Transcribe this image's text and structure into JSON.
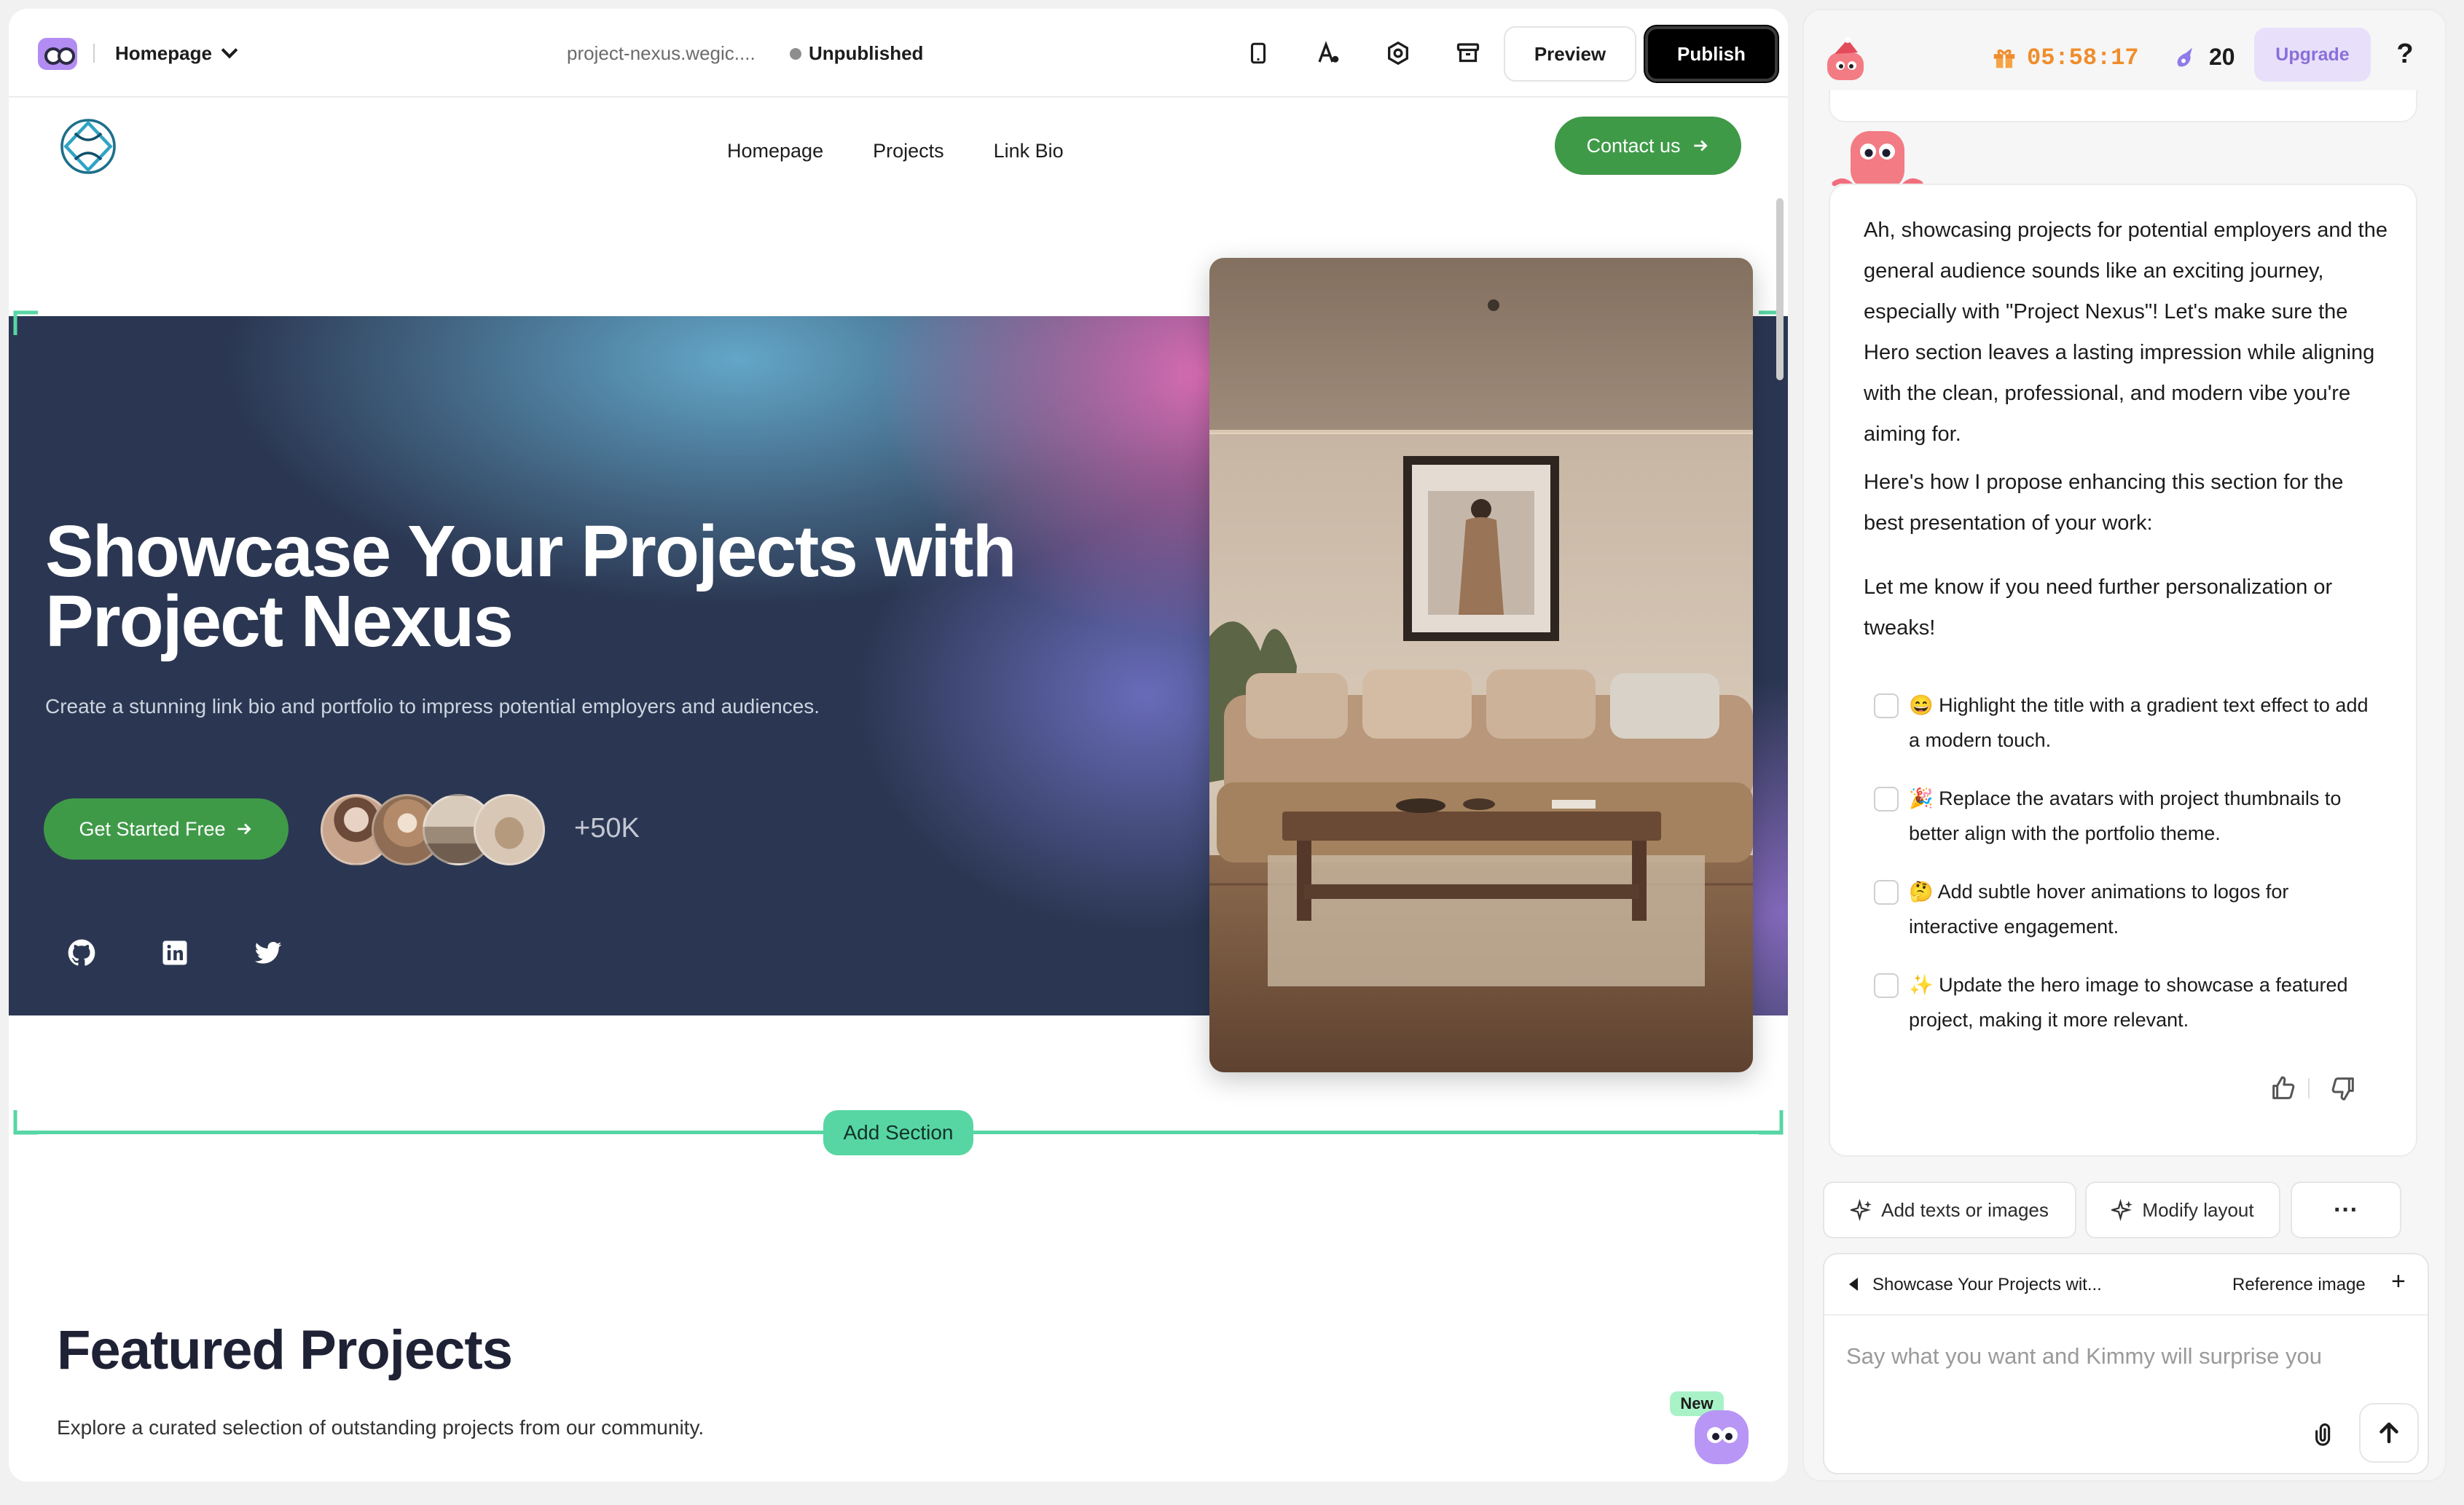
{
  "editor": {
    "page_select": "Homepage",
    "site_url": "project-nexus.wegic....",
    "publish_status": "Unpublished",
    "preview_label": "Preview",
    "publish_label": "Publish",
    "tools": [
      "mobile-view-icon",
      "typography-icon",
      "settings-icon",
      "archive-icon"
    ]
  },
  "site": {
    "nav": [
      "Homepage",
      "Projects",
      "Link Bio"
    ],
    "contact_label": "Contact us",
    "hero": {
      "title": "Showcase Your Projects with Project Nexus",
      "subtitle": "Create a stunning link bio and portfolio to impress potential employers and audiences.",
      "cta_label": "Get Started Free",
      "social_count": "+50K",
      "social_icons": [
        "github-icon",
        "linkedin-icon",
        "twitter-icon"
      ]
    },
    "add_section_label": "Add Section",
    "featured": {
      "title": "Featured Projects",
      "subtitle": "Explore a curated selection of outstanding projects from our community."
    },
    "new_badge": "New"
  },
  "chat": {
    "timer": "05:58:17",
    "credits": "20",
    "upgrade_label": "Upgrade",
    "help_label": "?",
    "message": {
      "p1": "Ah, showcasing projects for potential employers and the general audience sounds like an exciting journey, especially with \"Project Nexus\"! Let's make sure the Hero section leaves a lasting impression while aligning with the clean, professional, and modern vibe you're aiming for.",
      "p2": "Here's how I propose enhancing this section for the best presentation of your work:",
      "p3": "Let me know if you need further personalization or tweaks!",
      "checklist": [
        "😄 Highlight the title with a gradient text effect to add a modern touch.",
        "🎉 Replace the avatars with project thumbnails to better align with the portfolio theme.",
        "🤔 Add subtle hover animations to logos for interactive engagement.",
        "✨ Update the hero image to showcase a featured project, making it more relevant."
      ]
    },
    "quick_actions": {
      "add": "Add texts or images",
      "modify": "Modify layout",
      "more": "···"
    },
    "composer": {
      "context_title": "Showcase Your Projects wit...",
      "reference_label": "Reference image",
      "add_label": "+",
      "placeholder": "Say what you want and Kimmy will surprise you"
    }
  }
}
